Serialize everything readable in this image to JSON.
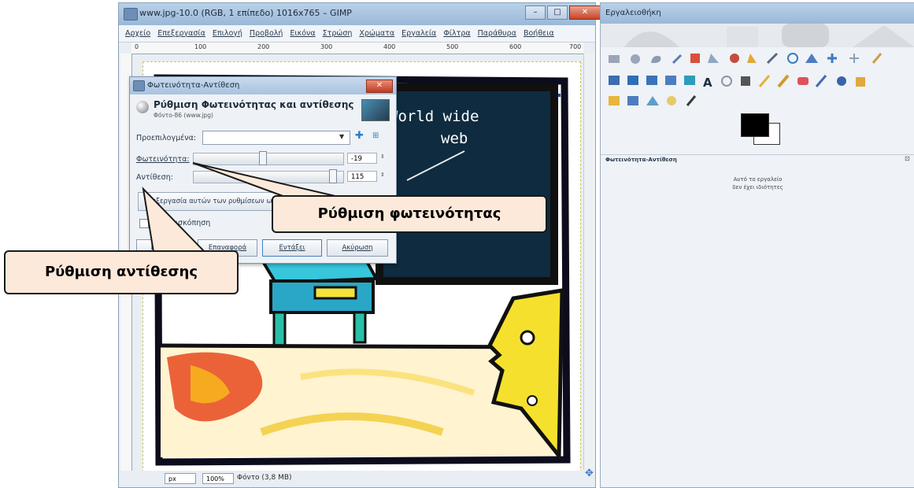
{
  "image_window": {
    "title": "www.jpg-10.0 (RGB, 1 επίπεδο) 1016x765 – GIMP",
    "menu": [
      "Αρχείο",
      "Επεξεργασία",
      "Επιλογή",
      "Προβολή",
      "Εικόνα",
      "Στρώση",
      "Χρώματα",
      "Εργαλεία",
      "Φίλτρα",
      "Παράθυρα",
      "Βοήθεια"
    ],
    "ruler_ticks": [
      "0",
      "100",
      "200",
      "300",
      "400",
      "500",
      "600",
      "700"
    ],
    "status": {
      "unit": "px",
      "zoom": "100%",
      "text": "Φόντο (3,8 MB)"
    },
    "canvas": {
      "board_text_line1": "World wide",
      "board_text_line2": "web"
    }
  },
  "dialog": {
    "title": "Φωτεινότητα-Αντίθεση",
    "close_label": "✕",
    "heading": "Ρύθμιση Φωτεινότητας και αντίθεσης",
    "subheading": "Φόντο-86 (www.jpg)",
    "presets_label": "Προεπιλογμένα:",
    "brightness_label": "Φωτεινότητα:",
    "brightness_value": "-19",
    "brightness_fraction": 0.46,
    "contrast_label": "Αντίθεση:",
    "contrast_value": "115",
    "contrast_fraction": 0.95,
    "edit_curves_label": "Επεξεργασία αυτών των ρυθμίσεων ως καμπύλες",
    "preview_label": "Προεπισκόπηση",
    "buttons": {
      "help": "Βοήθεια",
      "reset": "Επαναφορά",
      "ok": "Εντάξει",
      "cancel": "Ακύρωση"
    }
  },
  "toolbox": {
    "title": "Εργαλειοθήκη",
    "tool_options_title": "Φωτεινότητα-Αντίθεση",
    "tool_options_message_line1": "Αυτό το εργαλείο",
    "tool_options_message_line2": "δεν έχει ιδιότητες",
    "fg_color": "#000000",
    "bg_color": "#ffffff"
  },
  "callouts": {
    "brightness": "Ρύθμιση φωτεινότητας",
    "contrast": "Ρύθμιση αντίθεσης"
  }
}
